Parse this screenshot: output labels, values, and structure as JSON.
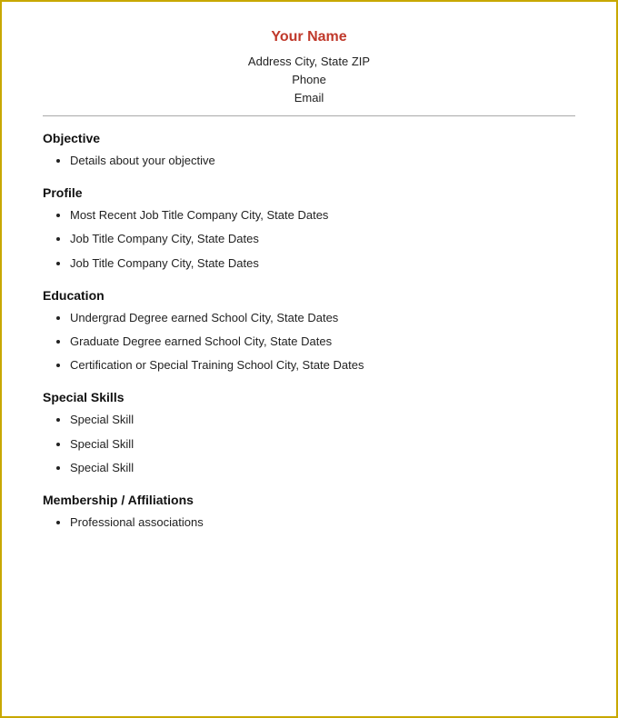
{
  "header": {
    "name": "Your Name",
    "address": "Address   City,  State   ZIP",
    "phone": "Phone",
    "email": "Email"
  },
  "sections": [
    {
      "id": "objective",
      "title": "Objective",
      "items": [
        "Details about your objective"
      ]
    },
    {
      "id": "profile",
      "title": "Profile",
      "items": [
        "Most Recent Job Title   Company   City,  State   Dates",
        "Job Title   Company   City,  State   Dates",
        "Job Title   Company   City,  State   Dates"
      ]
    },
    {
      "id": "education",
      "title": "Education",
      "items": [
        "Undergrad Degree earned   School   City,  State   Dates",
        "Graduate Degree earned   School   City,  State   Dates",
        "Certification or Special Training   School   City,  State   Dates"
      ]
    },
    {
      "id": "special-skills",
      "title": "Special Skills",
      "items": [
        "Special  Skill",
        "Special  Skill",
        "Special  Skill"
      ]
    },
    {
      "id": "membership",
      "title": "Membership / Affiliations",
      "items": [
        "Professional associations"
      ]
    }
  ]
}
